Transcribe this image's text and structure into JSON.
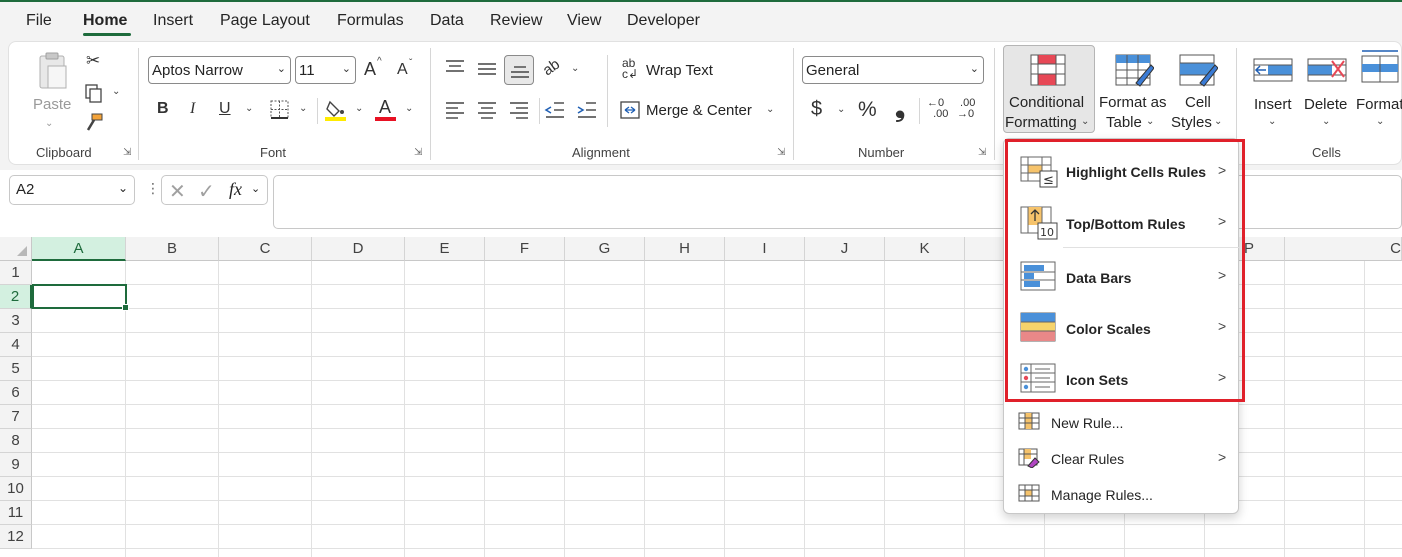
{
  "menu_tabs": [
    "File",
    "Home",
    "Insert",
    "Page Layout",
    "Formulas",
    "Data",
    "Review",
    "View",
    "Developer"
  ],
  "clipboard": {
    "paste": "Paste",
    "group": "Clipboard"
  },
  "font": {
    "name": "Aptos Narrow",
    "size": "11",
    "group": "Font",
    "grow": "A",
    "shrink": "A",
    "bold": "B",
    "italic": "I",
    "underline": "U",
    "color_a": "A"
  },
  "alignment": {
    "wrap": "Wrap Text",
    "merge": "Merge & Center",
    "group": "Alignment"
  },
  "number": {
    "format": "General",
    "group": "Number",
    "currency": "$",
    "percent": "%",
    "comma": "‚",
    "inc_dec": ".00",
    "dec_dec": ".00"
  },
  "styles": {
    "cf_line1": "Conditional",
    "cf_line2": "Formatting",
    "fat_line1": "Format as",
    "fat_line2": "Table",
    "cs_line1": "Cell",
    "cs_line2": "Styles"
  },
  "cells": {
    "insert": "Insert",
    "delete": "Delete",
    "format": "Format",
    "group": "Cells"
  },
  "name_box": "A2",
  "fx": "fx",
  "columns": [
    "A",
    "B",
    "C",
    "D",
    "E",
    "F",
    "G",
    "H",
    "I",
    "J",
    "K",
    "",
    "",
    "O",
    "P",
    "C"
  ],
  "rows": [
    "1",
    "2",
    "3",
    "4",
    "5",
    "6",
    "7",
    "8",
    "9",
    "10",
    "11",
    "12"
  ],
  "cf_menu": {
    "items": [
      "Highlight Cells Rules",
      "Top/Bottom Rules",
      "Data Bars",
      "Color Scales",
      "Icon Sets"
    ],
    "small": [
      "New Rule...",
      "Clear Rules",
      "Manage Rules..."
    ]
  },
  "colors": {
    "accent": "#1e6b3c",
    "highlight": "#e0202a"
  }
}
